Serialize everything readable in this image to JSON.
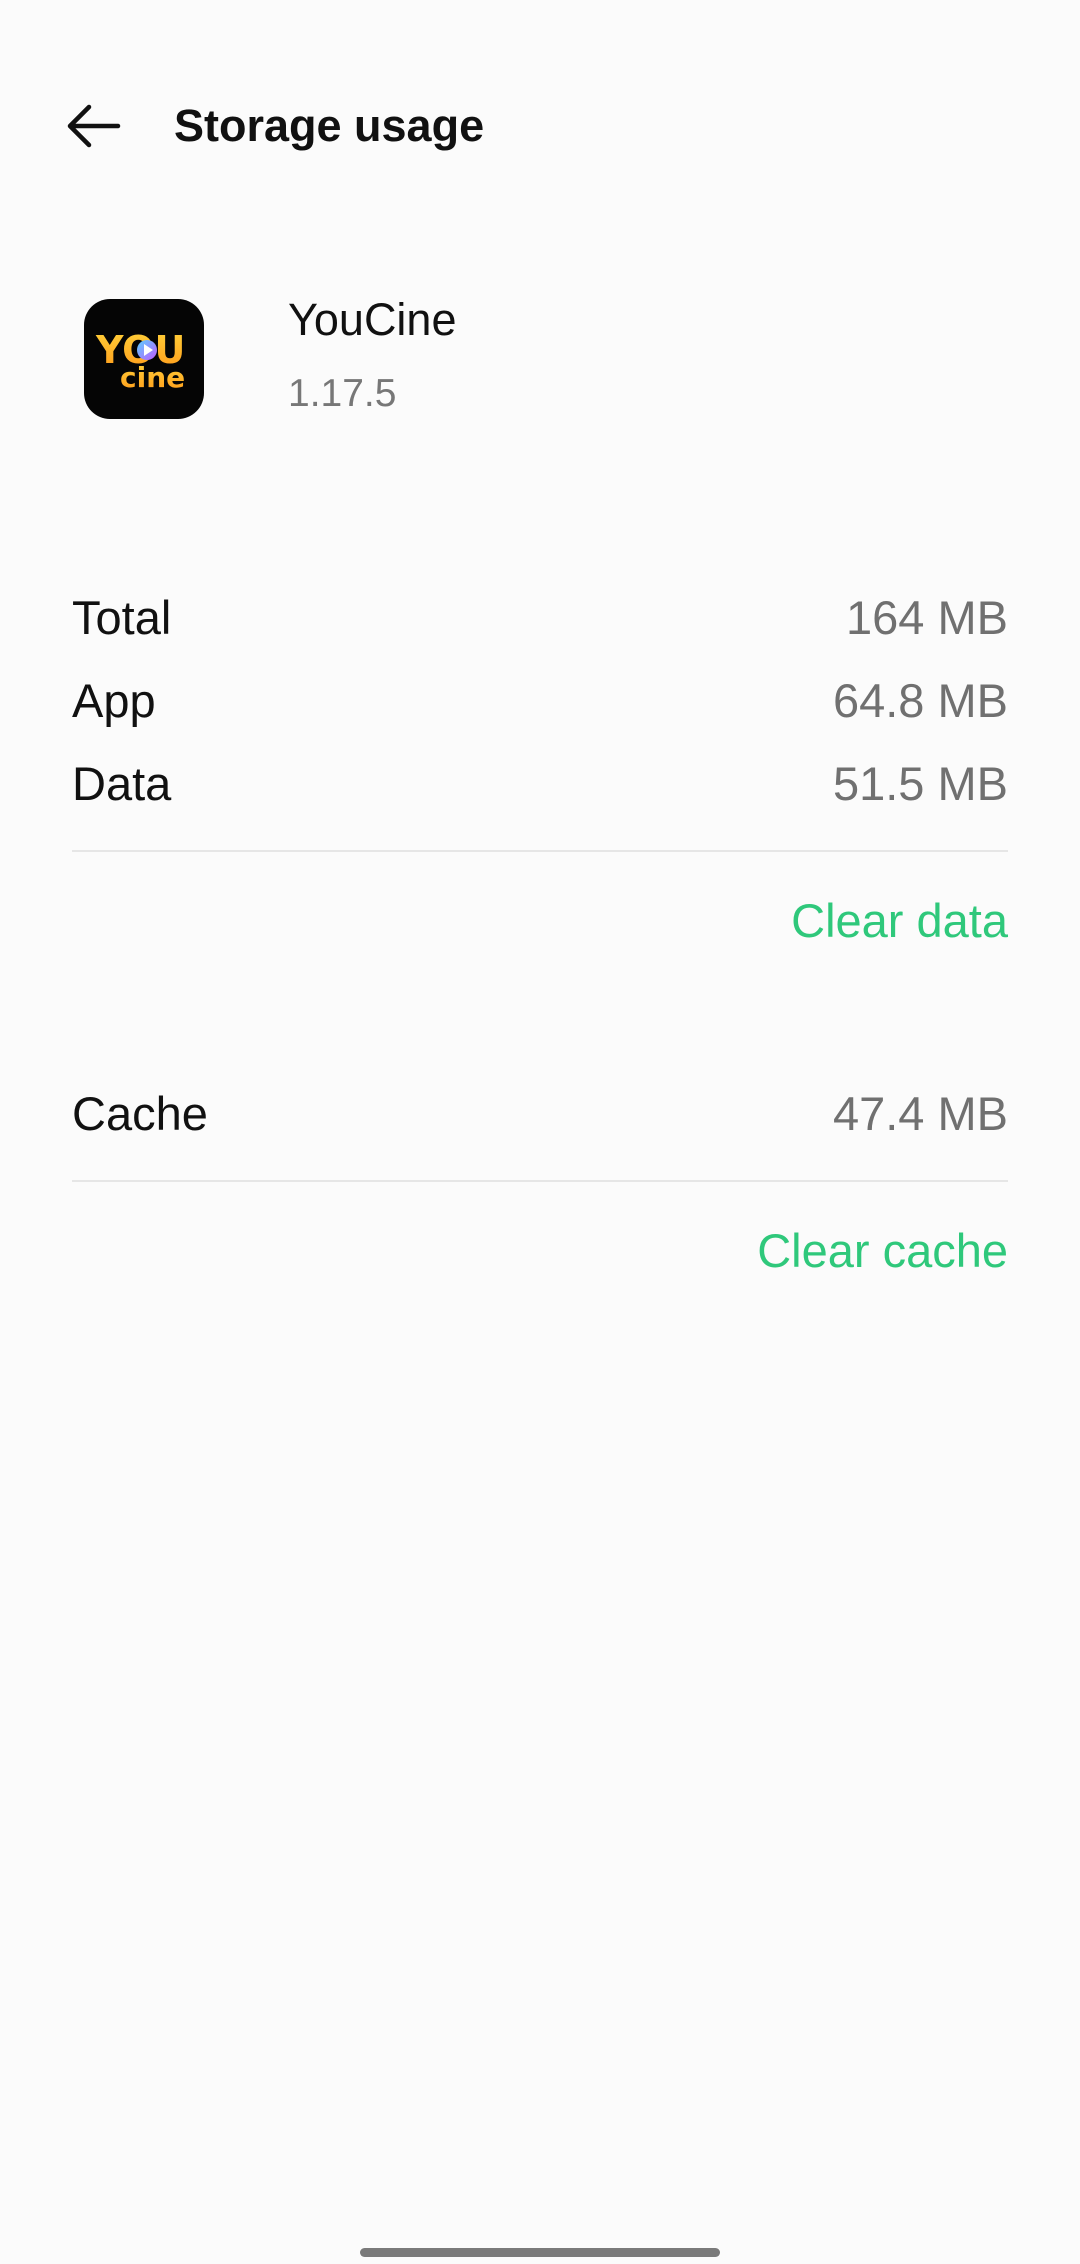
{
  "header": {
    "title": "Storage usage",
    "back_icon": "arrow-left-icon"
  },
  "app": {
    "name": "YouCine",
    "version": "1.17.5",
    "icon": "youcine-logo-icon",
    "icon_logo_text_top": "YOU",
    "icon_logo_text_bottom": "cine"
  },
  "storage": {
    "rows": [
      {
        "label": "Total",
        "value": "164 MB"
      },
      {
        "label": "App",
        "value": "64.8 MB"
      },
      {
        "label": "Data",
        "value": "51.5 MB"
      }
    ],
    "clear_data_label": "Clear data"
  },
  "cache": {
    "label": "Cache",
    "value": "47.4 MB",
    "clear_cache_label": "Clear cache"
  },
  "colors": {
    "accent": "#2fc87b",
    "background": "#fbfbfb",
    "secondary_text": "#707070"
  }
}
